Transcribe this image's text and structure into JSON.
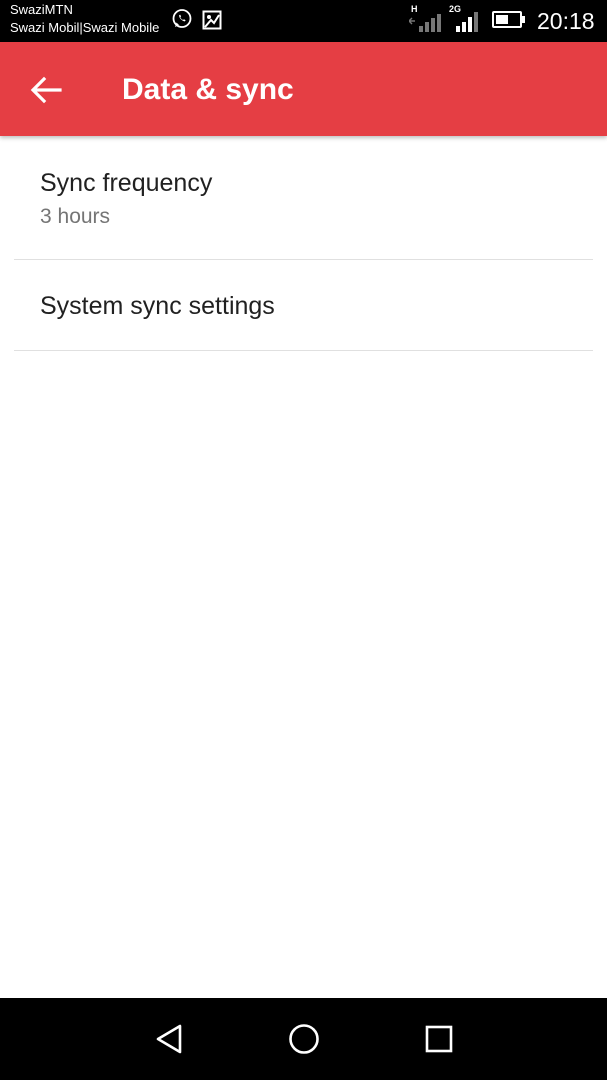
{
  "status_bar": {
    "carrier_1": "SwaziMTN",
    "carrier_2": "Swazi Mobil|Swazi Mobile",
    "network_1": "H",
    "network_2": "2G",
    "time": "20:18",
    "battery_level": 0.55,
    "icons": [
      "whatsapp-icon",
      "image-icon",
      "signal-icon",
      "battery-icon"
    ]
  },
  "app_bar": {
    "title": "Data & sync",
    "background": "#e53e44",
    "back_icon": "arrow-back-icon"
  },
  "preferences": [
    {
      "title": "Sync frequency",
      "summary": "3 hours"
    },
    {
      "title": "System sync settings"
    }
  ],
  "nav_bar": {
    "icons": [
      "back-triangle-icon",
      "home-circle-icon",
      "recents-square-icon"
    ]
  }
}
